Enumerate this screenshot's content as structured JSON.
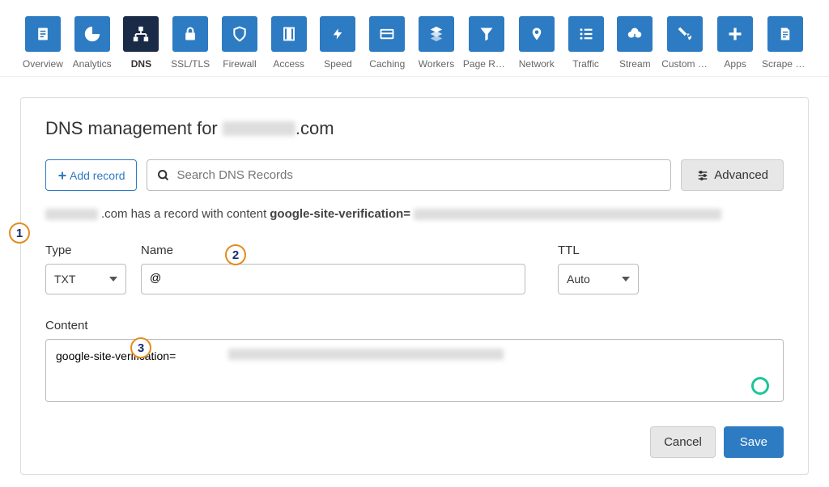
{
  "nav": {
    "items": [
      {
        "label": "Overview",
        "icon": "clipboard"
      },
      {
        "label": "Analytics",
        "icon": "pie"
      },
      {
        "label": "DNS",
        "icon": "hierarchy",
        "active": true
      },
      {
        "label": "SSL/TLS",
        "icon": "lock"
      },
      {
        "label": "Firewall",
        "icon": "shield-check"
      },
      {
        "label": "Access",
        "icon": "door"
      },
      {
        "label": "Speed",
        "icon": "bolt"
      },
      {
        "label": "Caching",
        "icon": "card"
      },
      {
        "label": "Workers",
        "icon": "stack"
      },
      {
        "label": "Page Rules",
        "icon": "funnel"
      },
      {
        "label": "Network",
        "icon": "pin"
      },
      {
        "label": "Traffic",
        "icon": "list"
      },
      {
        "label": "Stream",
        "icon": "cloud"
      },
      {
        "label": "Custom P...",
        "icon": "wrench"
      },
      {
        "label": "Apps",
        "icon": "plus"
      },
      {
        "label": "Scrape S...",
        "icon": "doc"
      }
    ]
  },
  "panel": {
    "title_prefix": "DNS management for ",
    "title_suffix": ".com",
    "add_record": "Add record",
    "search_placeholder": "Search DNS Records",
    "advanced": "Advanced",
    "info_suffix1": ".com has a record with content ",
    "info_bold": "google-site-verification=",
    "form": {
      "type_label": "Type",
      "type_value": "TXT",
      "name_label": "Name",
      "name_value": "@",
      "ttl_label": "TTL",
      "ttl_value": "Auto",
      "content_label": "Content",
      "content_value": "google-site-verification="
    },
    "cancel": "Cancel",
    "save": "Save"
  },
  "annotations": [
    "1",
    "2",
    "3"
  ]
}
